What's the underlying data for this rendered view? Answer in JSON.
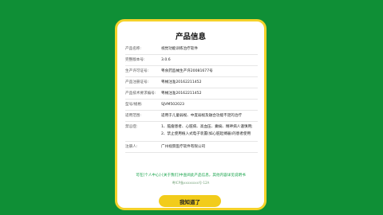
{
  "dialog": {
    "title": "产品信息",
    "rows": [
      {
        "label": "产品名称:",
        "value": "视觉功能训练治疗软件"
      },
      {
        "label": "完整版本号:",
        "value": "3.0.6"
      },
      {
        "label": "生产许可证号:",
        "value": "粤食药监械生产许20081677号"
      },
      {
        "label": "产品注册证号:",
        "value": "粤械注准20162211452"
      },
      {
        "label": "产品技术要求编号:",
        "value": "粤械注准20162211452"
      },
      {
        "label": "型号/规格:",
        "value": "SJVM502023"
      },
      {
        "label": "适用范围:",
        "value": "适用于儿童弱视、中度弱视及融合功能不足的治疗"
      },
      {
        "label": "禁忌症:",
        "lines": [
          "1、脑瘤患者、心脏病、高血压、癫痫、精神病人谨慎用;",
          "2、禁止使用植入式电子装置(如心脏起搏器)的患者使用"
        ]
      },
      {
        "label": "注册人:",
        "value": "广州视景医疗软件有限公司"
      }
    ],
    "notice": "可在[个人中心]-[关于我们]中查阅此产品信息，其他内容详见说明书",
    "icp": "粤ICP备xxxxxxxx号-12A",
    "confirm_label": "我知道了"
  },
  "colors": {
    "background": "#0f8f36",
    "border": "#f4d22a",
    "button": "#f2cc1b",
    "notice": "#17a34a"
  }
}
